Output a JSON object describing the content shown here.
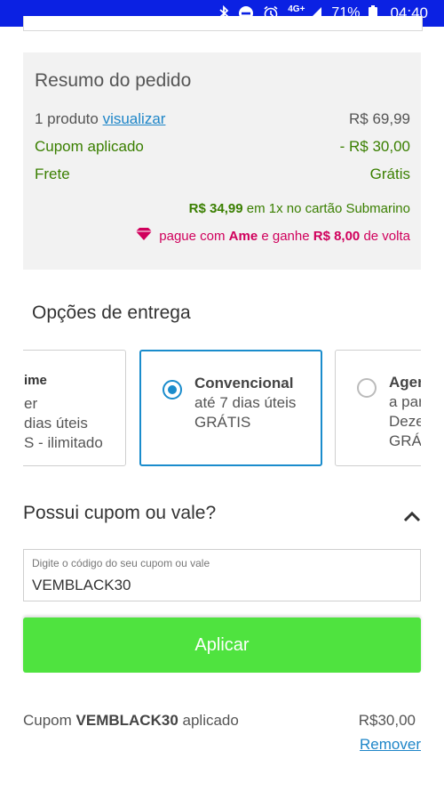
{
  "status_bar": {
    "network": "4G+",
    "battery": "71%",
    "time": "04:40",
    "icons": [
      "bluetooth-icon",
      "do-not-disturb-icon",
      "alarm-icon",
      "signal-icon",
      "battery-icon"
    ]
  },
  "summary": {
    "title": "Resumo do pedido",
    "products": {
      "label": "1 produto",
      "link": "visualizar",
      "value": "R$ 69,99"
    },
    "coupon": {
      "label": "Cupom aplicado",
      "value": "- R$ 30,00"
    },
    "shipping": {
      "label": "Frete",
      "value": "Grátis"
    },
    "installment": {
      "amount": "R$ 34,99",
      "text": " em 1x no cartão Submarino"
    },
    "ame": {
      "pre": "pague com ",
      "brand": "Ame",
      "mid": " e ganhe ",
      "cashback": "R$ 8,00",
      "post": " de volta"
    }
  },
  "delivery": {
    "title": "Opções de entrega",
    "options": [
      {
        "name": "ime",
        "detail": "er",
        "days": "dias úteis",
        "price": "S - ilimitado",
        "selected": false
      },
      {
        "name": "Convencional",
        "days": "até 7 dias úteis",
        "price": "GRÁTIS",
        "selected": true
      },
      {
        "name": "Agen",
        "days": "a par",
        "detail": "Deze",
        "price": "GRÁT",
        "selected": false
      }
    ]
  },
  "coupon": {
    "title": "Possui cupom ou vale?",
    "field_label": "Digite o código do seu cupom ou vale",
    "value": "VEMBLACK30",
    "apply_label": "Aplicar",
    "applied_prefix": "Cupom ",
    "applied_code": "VEMBLACK30",
    "applied_suffix": " aplicado",
    "applied_value": "R$30,00",
    "remove_label": "Remover"
  },
  "colors": {
    "status_bar": "#0b21e3",
    "green_text": "#3a7f00",
    "ame_pink": "#d0005c",
    "link_blue": "#1f86c8",
    "selected_border": "#1a8ccc",
    "apply_button": "#4fe33f"
  }
}
